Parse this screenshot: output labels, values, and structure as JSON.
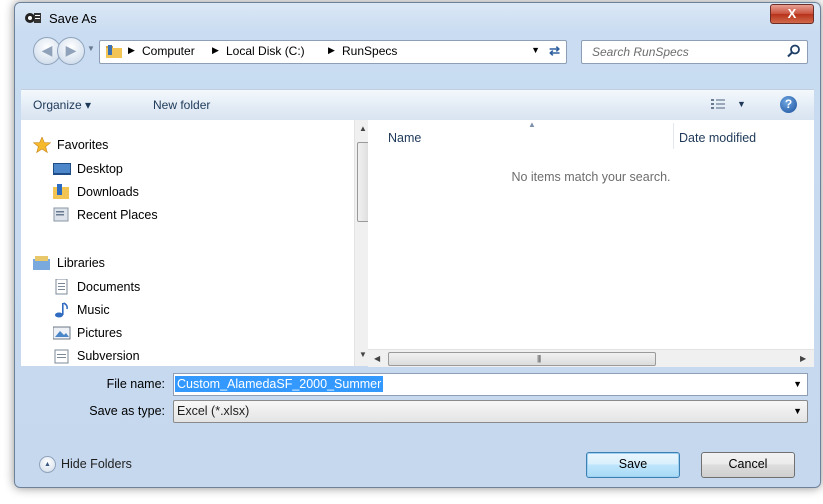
{
  "window": {
    "title": "Save As",
    "close_label": "X"
  },
  "address": {
    "crumbs": [
      "Computer",
      "Local Disk (C:)",
      "RunSpecs"
    ]
  },
  "search": {
    "placeholder": "Search RunSpecs"
  },
  "toolbar": {
    "organize_label": "Organize ▾",
    "new_folder_label": "New folder",
    "help_label": "?"
  },
  "nav": {
    "favorites": {
      "label": "Favorites",
      "items": [
        "Desktop",
        "Downloads",
        "Recent Places"
      ]
    },
    "libraries": {
      "label": "Libraries",
      "items": [
        "Documents",
        "Music",
        "Pictures",
        "Subversion"
      ]
    }
  },
  "file_list": {
    "columns": [
      "Name",
      "Date modified"
    ],
    "empty_message": "No items match your search."
  },
  "form": {
    "file_name_label": "File name:",
    "file_name_value": "Custom_AlamedaSF_2000_Summer",
    "save_type_label": "Save as type:",
    "save_type_value": "Excel (*.xlsx)"
  },
  "footer": {
    "hide_folders_label": "Hide Folders",
    "save_label": "Save",
    "cancel_label": "Cancel"
  },
  "colors": {
    "selection": "#3399ff",
    "window_frame": "#c5d8ee",
    "close": "#c9503c"
  }
}
